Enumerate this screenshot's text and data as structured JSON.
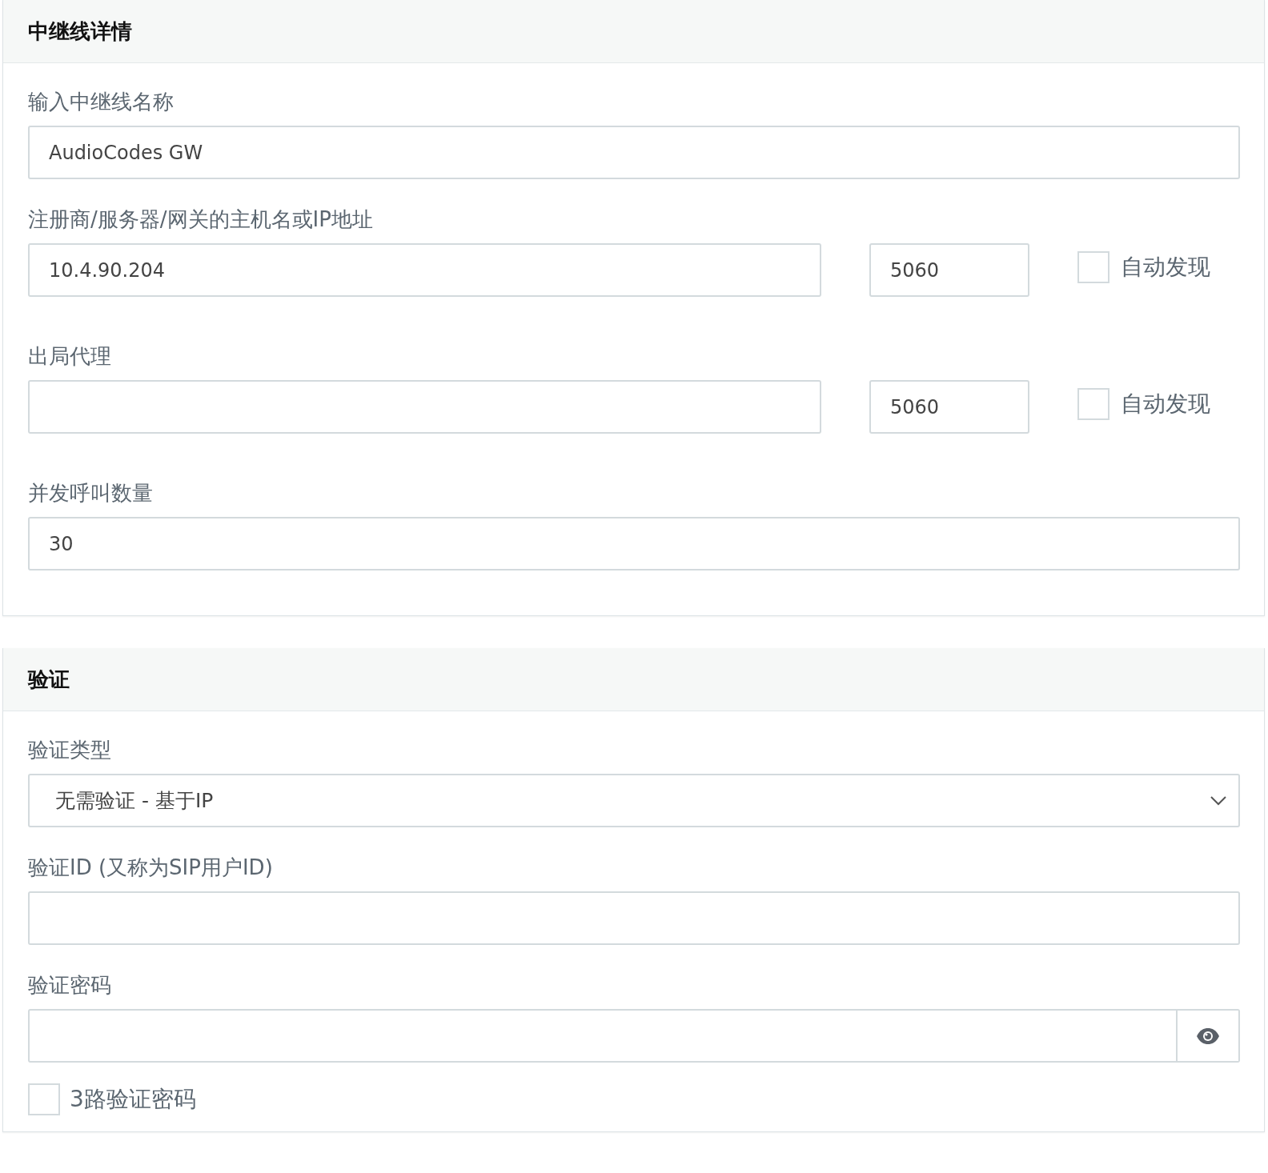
{
  "sections": [
    {
      "title": "中继线详情",
      "fields": [
        {
          "kind": "text",
          "label": "输入中继线名称",
          "value": "AudioCodes GW"
        },
        {
          "kind": "host",
          "label": "注册商/服务器/网关的主机名或IP地址",
          "value": "10.4.90.204",
          "port": "5060",
          "autodiscover": {
            "label": "自动发现",
            "checked": false
          }
        },
        {
          "kind": "host",
          "label": "出局代理",
          "port": "5060",
          "autodiscover": {
            "label": "自动发现",
            "checked": false
          }
        },
        {
          "kind": "text",
          "label": "并发呼叫数量",
          "value": "30"
        }
      ]
    },
    {
      "title": "验证",
      "fields": [
        {
          "kind": "select",
          "label": "验证类型",
          "value": "无需验证 - 基于IP"
        },
        {
          "kind": "text",
          "label": "验证ID (又称为SIP用户ID)"
        },
        {
          "kind": "password",
          "label": "验证密码"
        },
        {
          "kind": "checkbox",
          "label": "3路验证密码",
          "checked": false
        }
      ]
    }
  ]
}
